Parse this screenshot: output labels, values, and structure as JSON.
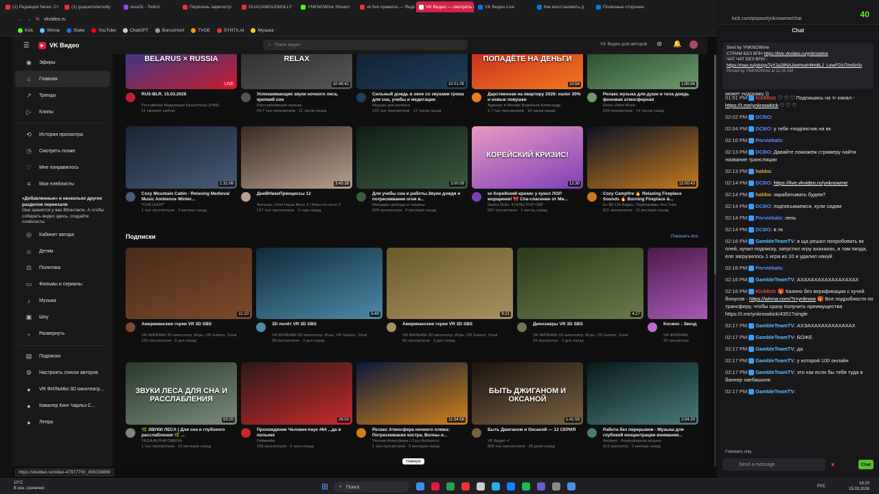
{
  "browser": {
    "tabs": [
      {
        "label": "(1) Редакция News: Ст",
        "color": "#e33"
      },
      {
        "label": "(1) guacamolemolly",
        "color": "#e33"
      },
      {
        "label": "ieva2k - Twitch",
        "color": "#9146ff"
      },
      {
        "label": "Перечень зарегистр",
        "color": "#e33"
      },
      {
        "label": "GUACAMOLEMOLLY",
        "color": "#e33"
      },
      {
        "label": "YNKNOWme Stream",
        "color": "#53fc18"
      },
      {
        "label": "vk live правила — Яндекс",
        "color": "#e33"
      },
      {
        "label": "VK Видео — смотреть о",
        "color": "#fff",
        "active": true
      },
      {
        "label": "VK Видео Live",
        "color": "#0077ff"
      },
      {
        "label": "Как восстановить д",
        "color": "#0077ff"
      },
      {
        "label": "Полезные сторонни",
        "color": "#0077ff"
      }
    ],
    "url": "vkvideo.ru",
    "bookmarks": [
      {
        "label": "Kick",
        "color": "#53fc18"
      },
      {
        "label": "Winna",
        "color": "#6cf"
      },
      {
        "label": "Stake",
        "color": "#1475e1"
      },
      {
        "label": "YouTube",
        "color": "#f00"
      },
      {
        "label": "ChatGPT",
        "color": "#ccc"
      },
      {
        "label": "BonusHunt",
        "color": "#999"
      },
      {
        "label": "TVOE",
        "color": "#f90"
      },
      {
        "label": "SYNTX.AI",
        "color": "#e33"
      },
      {
        "label": "Музыка",
        "color": "#fc0"
      }
    ],
    "status_url": "https://vkvideo.ru/video-47977700_456239889"
  },
  "vk": {
    "logo": "VK Видео",
    "search_placeholder": "Поиск видео",
    "authors_link": "VK Видео для авторов",
    "sidebar": [
      {
        "label": "Эфиры",
        "icon": "live-icon"
      },
      {
        "label": "Главная",
        "icon": "home-icon",
        "active": true
      },
      {
        "label": "Тренды",
        "icon": "trends-icon"
      },
      {
        "label": "Клипы",
        "icon": "clips-icon"
      },
      {
        "label": "История просмотра",
        "icon": "history-icon"
      },
      {
        "label": "Смотреть позже",
        "icon": "clock-icon"
      },
      {
        "label": "Мне понравилось",
        "icon": "heart-icon"
      },
      {
        "label": "Мои плейлисты",
        "icon": "playlist-icon"
      }
    ],
    "notice_title": "«Добавленные» и несколько других разделов переехали",
    "notice_body": "Они хранятся у вас ВКонтакте. А чтобы собирать видео здесь, создайте плейлисты",
    "sidebar2": [
      {
        "label": "Кабинет автора",
        "icon": "author-icon"
      },
      {
        "label": "Детям",
        "icon": "kids-icon"
      },
      {
        "label": "Политика",
        "icon": "politics-icon"
      },
      {
        "label": "Фильмы и сериалы",
        "icon": "film-icon"
      },
      {
        "label": "Музыка",
        "icon": "music-icon"
      },
      {
        "label": "Шоу",
        "icon": "show-icon"
      },
      {
        "label": "Развернуть",
        "icon": "chevron-down-icon"
      }
    ],
    "sidebar3": [
      {
        "label": "Подписки",
        "icon": "subs-icon"
      },
      {
        "label": "Настроить список авторов",
        "icon": "settings-icon"
      },
      {
        "label": "VR ФИЛЬМЫ 3D кинотеатр...",
        "icon": "avatar-icon"
      },
      {
        "label": "Кавалер Кинг Чарльз С...",
        "icon": "avatar-icon"
      },
      {
        "label": "Лепра",
        "icon": "avatar-icon"
      }
    ],
    "row1": [
      {
        "title": "RUS-BLR. 15.03.2026",
        "channel": "Российская Федерация Баскетбола (РФБ)",
        "meta": "11 смотрят сейчас",
        "badge": "LIVE",
        "c1": "#1b3f9e",
        "c2": "#c41d2e",
        "thumbtext": "BELARUS × RUSSIA"
      },
      {
        "title": "Успокаивающие звуки ночного леса, крепкий сон",
        "channel": "Расслабляющая музыка",
        "meta": "64,7 тыс просмотров · 11 часов назад",
        "dur": "10:49:42",
        "c1": "#2a2a2a",
        "c2": "#555",
        "thumbtext": "RELAX"
      },
      {
        "title": "Сильный дождь в окне со звуками грома для сна, учебы и медитации",
        "channel": "Музыка для релакса",
        "meta": "122 тыс просмотров · 12 часов назад",
        "dur": "10:01:05",
        "c1": "#0c1a2a",
        "c2": "#1f3e5a"
      },
      {
        "title": "Дарственная на квартиру 2026: налог 30% и новые ловушки",
        "channel": "Адвокат в Москве Воробьев Александр",
        "meta": "1,7 тыс просмотров · 15 часов назад",
        "dur": "10:54",
        "c1": "#c21f1f",
        "c2": "#ef7a20",
        "thumbtext": "ПОПАДЁТЕ НА ДЕНЬГИ"
      },
      {
        "title": "Релакс музыка для души и тела дождь фоновая атмосферная",
        "channel": "Relax Video Music",
        "meta": "626 просмотров · 14 часов назад",
        "dur": "1:00:04",
        "c1": "#1d3d1d",
        "c2": "#6e9a6e"
      }
    ],
    "row2": [
      {
        "title": "Cozy Mountain Cabin - Relaxing Medieval Music Ambience Winter...",
        "channel": "*CHILLHOP*",
        "meta": "1 тыс просмотров · 2 месяца назад",
        "dur": "1:31:06",
        "c1": "#1a2333",
        "c2": "#475b78"
      },
      {
        "title": "ДнеВНикиПринцессы 12",
        "channel": "Фильмы | Моя Наша Вина 3 | Макстон-холл 2",
        "meta": "157 тыс просмотров · 2 года назад",
        "dur": "3:43:38",
        "c1": "#3a2a22",
        "c2": "#b8a090"
      },
      {
        "title": "Для учебы сна и работы.Звуки дождя и потрескивание огня в...",
        "channel": "Мелодии свободы и тишины",
        "meta": "628 просмотров · 9 месяцев назад",
        "dur": "3:00:09",
        "c1": "#0f1d15",
        "c2": "#3b5a3f"
      },
      {
        "title": "кх Корейский кризис у кукол ЛОЛ морщинки! 🎀 Спа-спасение от Ми...",
        "channel": "Dasha Dolls: КУКЛЫ ЛОЛ ОМГ",
        "meta": "687 просмотров · 1 месяц назад",
        "dur": "12:30",
        "c1": "#e99ac2",
        "c2": "#7d3fb8",
        "thumbtext": "КОРЕЙСКИЙ КРИЗИС!"
      },
      {
        "title": "Cozy Campfire 🔥 Relaxing Fireplace Sounds 🔥 Burning Fireplace &...",
        "channel": "Ex Bk 12k Видео. Перезаливы You Tube",
        "meta": "811 просмотров · 11 месяцев назад",
        "dur": "12:00:43",
        "c1": "#0b1226",
        "c2": "#c47a1d"
      }
    ],
    "subs_title": "Подписки",
    "show_all": "Показать все",
    "subs": [
      {
        "title": "Американские горки VR 3D SBS",
        "channel": "VR ФИЛЬМЫ 3D кинотеатр, Игры, VR Games, Xreal",
        "meta": "155 просмотров · 3 дня назад",
        "dur": "11:10",
        "c1": "#4a2a1a",
        "c2": "#7a4a2a"
      },
      {
        "title": "3D полёт VR 3D SBS",
        "channel": "VR ФИЛЬМЫ 3D кинотеатр, Игры, VR Games, Xreal",
        "meta": "58 просмотров · 3 дня назад",
        "dur": "5:40",
        "c1": "#0f2a3a",
        "c2": "#4e8aa8"
      },
      {
        "title": "Американские горки VR 3D SBS",
        "channel": "VR ФИЛЬМЫ 3D кинотеатр, Игры, VR Games, Xreal",
        "meta": "60 просмотров · 3 дня назад",
        "dur": "9:21",
        "c1": "#6a5a2a",
        "c2": "#a89060"
      },
      {
        "title": "Динозавры VR 3D SBS",
        "channel": "VR ФИЛЬМЫ 3D кинотеатр, Игры, VR Games, Xreal",
        "meta": "33 просмотра · 3 дня назад",
        "dur": "4:27",
        "c1": "#2a3a1a",
        "c2": "#6a7a4a"
      },
      {
        "title": "Космос : Звезд",
        "channel": "VR ФИЛЬМЫ",
        "meta": "32 просмотра",
        "dur": "",
        "c1": "#4a1a4a",
        "c2": "#c06ad0"
      }
    ],
    "row4": [
      {
        "title": "🌿 ЗВУКИ ЛЕСА | Для сна и глубокого расслабления 🌿 ...",
        "channel": "SEGA ALPHA OMEGA",
        "meta": "1 тыс просмотров · 10 месяцев назад",
        "dur": "53:20",
        "c1": "#2a3a2a",
        "c2": "#7a8a7a",
        "thumbtext": "ЗВУКИ ЛЕСА ДЛЯ СНА И РАССЛАБЛЕНИЯ"
      },
      {
        "title": "Прохождение Человек-паук #64 ...да в полымя",
        "channel": "Геймкейм",
        "meta": "169 просмотров · 2 часа назад",
        "dur": "26:03",
        "c1": "#2a1a1a",
        "c2": "#c62a2a"
      },
      {
        "title": "Релакс Атмосфера ночного пляжа: Потрескивание костра, Волны и...",
        "channel": "Уютная Атмосфера | Cozy Ambience",
        "meta": "1 тыс просмотров · 5 месяцев назад",
        "dur": "11:54:58",
        "c1": "#0a1a3a",
        "c2": "#d0801a"
      },
      {
        "title": "Быть Джиганом и Оксаной — 12 СЕРИЯ",
        "channel": "VK Видео ✔",
        "meta": "808 тыс просмотров · 28 дней назад",
        "dur": "1:41:59",
        "c1": "#1a1410",
        "c2": "#7a6040",
        "thumbtext": "БЫТЬ ДЖИГАНОМ И ОКСАНОЙ"
      },
      {
        "title": "Работа без перерывов - Музыка для глубокой концентрации внимания...",
        "channel": "Ambient - Атмосферная музыка",
        "meta": "621 просмотр · 3 месяца назад",
        "dur": "2:04:20",
        "c1": "#0a1a1a",
        "c2": "#4a7a7a"
      }
    ]
  },
  "chat": {
    "header": "Chat",
    "url": "kick.com/popout/ynknowme/chat",
    "pinned_sender": "Sent by YNKNOWme",
    "pinned_text1": "СТРИМ БЕЗ ВПН",
    "pinned_link1": "https://live.vkvideo.ru/ynknowme",
    "pinned_text2": "ЧАТ ЧАТ БЕЗ ВПН -",
    "pinned_link2": "https://max.ru/join/gxTyYJa28NAJeeHsvlr4lHdtLJ_LviwFD1lTrto5n0s",
    "pinned_by": "Pinned by YNKNOWme at 11:26 AM",
    "first_line": "может подскажу ))",
    "messages": [
      {
        "time": "01:51 PM",
        "user": "KickBot",
        "color": "#e3463a",
        "text": ": ♡ ♡ ♡ Подпишись на тг канал -",
        "link": "https://t.me/ynknowkick",
        "tail": " ♡ ♡ ♡"
      },
      {
        "time": "02:02 PM",
        "user": "DCBO",
        "color": "#5b8cff",
        "text": ":",
        "link": "",
        "tail": ""
      },
      {
        "time": "02:04 PM",
        "user": "DCBO",
        "color": "#5b8cff",
        "text": ": у тебя +подписчик на вк",
        "link": "",
        "tail": ""
      },
      {
        "time": "02:10 PM",
        "user": "Porviebalo",
        "color": "#5b8cff",
        "text": ":",
        "link": "",
        "tail": ""
      },
      {
        "time": "02:13 PM",
        "user": "DCBO",
        "color": "#5b8cff",
        "text": ": Давайте поможем стримеру найти название трансляции",
        "link": "",
        "tail": ""
      },
      {
        "time": "02:13 PM",
        "user": "habba",
        "color": "#e3a33a",
        "text": ":",
        "link": "",
        "tail": ""
      },
      {
        "time": "02:14 PM",
        "user": "DCBO",
        "color": "#5b8cff",
        "text": ":",
        "link": "https://live.vkvideo.ru/ynknowme",
        "tail": ""
      },
      {
        "time": "02:14 PM",
        "user": "habba",
        "color": "#e3a33a",
        "text": ": зарабатывать будем?",
        "link": "",
        "tail": ""
      },
      {
        "time": "02:14 PM",
        "user": "DCBO",
        "color": "#5b8cff",
        "text": ": подписываемся, хули сидим",
        "link": "",
        "tail": ""
      },
      {
        "time": "02:14 PM",
        "user": "Porviebalo",
        "color": "#5b8cff",
        "text": ": лень",
        "link": "",
        "tail": ""
      },
      {
        "time": "02:14 PM",
        "user": "DCBO",
        "color": "#5b8cff",
        "text": ": в.тв",
        "link": "",
        "tail": ""
      },
      {
        "time": "02:16 PM",
        "user": "GambleTeamTV",
        "color": "#5bc0ff",
        "text": ": я ща решил попробовать вк плей, купил подписку, запустил игру ахахахах, и там пизда, еле загрузилось 1 игра из 10 и удалил нахуй",
        "link": "",
        "tail": ""
      },
      {
        "time": "02:16 PM",
        "user": "Porviebalo",
        "color": "#5b8cff",
        "text": ":",
        "link": "",
        "tail": ""
      },
      {
        "time": "02:16 PM",
        "user": "GambleTeamTV",
        "color": "#5bc0ff",
        "text": ": АХАХАХАХАХАХАХАХАХ",
        "link": "",
        "tail": ""
      },
      {
        "time": "02:16 PM",
        "user": "KickBot",
        "color": "#e3463a",
        "text": ": 🎁 Казино без верификации с кучей бонусов -",
        "link": "https://winna.com/?r=ynknow",
        "tail": " 🎁 Все подробности по трансферу, чтобы сразу получить преимущества https://t.me/ynknowkick/4351?single"
      },
      {
        "time": "02:17 PM",
        "user": "GambleTeamTV",
        "color": "#5bc0ff",
        "text": ": АХЭАХАХАХАХАХАХАХ",
        "link": "",
        "tail": ""
      },
      {
        "time": "02:17 PM",
        "user": "GambleTeamTV",
        "color": "#5bc0ff",
        "text": ": БОЖЕ",
        "link": "",
        "tail": ""
      },
      {
        "time": "02:17 PM",
        "user": "GambleTeamTV",
        "color": "#5bc0ff",
        "text": ": да",
        "link": "",
        "tail": ""
      },
      {
        "time": "02:17 PM",
        "user": "GambleTeamTV",
        "color": "#5bc0ff",
        "text": ": у которой 100 онлайн",
        "link": "",
        "tail": ""
      },
      {
        "time": "02:17 PM",
        "user": "GambleTeamTV",
        "color": "#5bc0ff",
        "text": ": это как если бы тебя туда в баннер заебашили",
        "link": "",
        "tail": ""
      },
      {
        "time": "02:17 PM",
        "user": "GambleTeamTV",
        "color": "#5bc0ff",
        "text": ":",
        "link": "",
        "tail": ""
      }
    ],
    "followers_only": "Followers only",
    "input_placeholder": "Send a message",
    "send_label": "Chat"
  },
  "taskbar": {
    "weather_temp": "10°C",
    "weather_desc": "В осн. солнечно",
    "search_label": "Поиск",
    "lang": "РУС",
    "time": "18:20",
    "date": "15.03.2026"
  },
  "popup_text": "Наверх"
}
